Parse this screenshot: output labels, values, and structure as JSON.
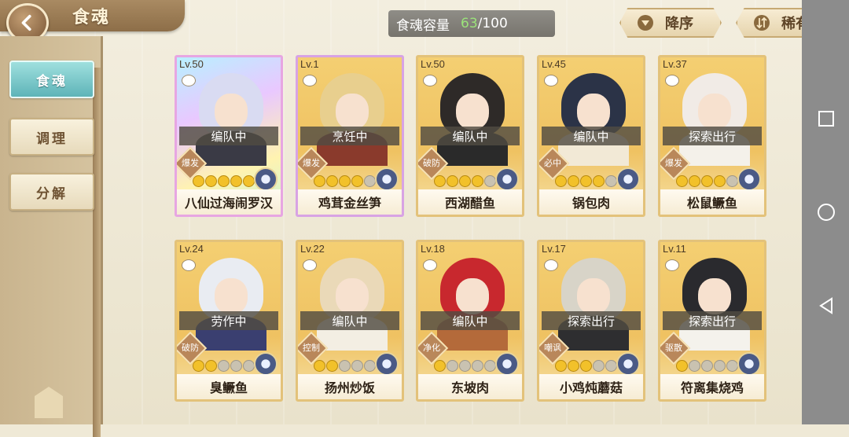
{
  "header": {
    "title": "食魂",
    "capacity_label": "食魂容量",
    "capacity_count": "63",
    "capacity_max": "/100"
  },
  "sort": {
    "order_label": "降序",
    "rarity_label": "稀有度"
  },
  "sidebar": {
    "items": [
      {
        "label": "食魂",
        "active": true
      },
      {
        "label": "调理",
        "active": false
      },
      {
        "label": "分解",
        "active": false
      }
    ]
  },
  "cards": [
    {
      "level": "Lv.50",
      "status": "编队中",
      "role": "爆发",
      "stars": 5,
      "name": "八仙过海闹罗汉",
      "frame": "rainbow",
      "hair": "#d9dbf2",
      "outfit": "#3a3a45"
    },
    {
      "level": "Lv.1",
      "status": "烹饪中",
      "role": "爆发",
      "stars": 4,
      "name": "鸡茸金丝笋",
      "frame": "purple",
      "hair": "#e8cf8e",
      "outfit": "#8a3a2c"
    },
    {
      "level": "Lv.50",
      "status": "编队中",
      "role": "破防",
      "stars": 4,
      "name": "西湖醋鱼",
      "frame": "gold",
      "hair": "#2e2a28",
      "outfit": "#2a2a2a"
    },
    {
      "level": "Lv.45",
      "status": "编队中",
      "role": "必中",
      "stars": 4,
      "name": "锅包肉",
      "frame": "gold",
      "hair": "#2b3347",
      "outfit": "#f2e9d6"
    },
    {
      "level": "Lv.37",
      "status": "探索出行",
      "role": "爆发",
      "stars": 4,
      "name": "松鼠鳜鱼",
      "frame": "gold",
      "hair": "#f1ebe6",
      "outfit": "#f4f1ea"
    },
    {
      "level": "Lv.24",
      "status": "劳作中",
      "role": "破防",
      "stars": 2,
      "name": "臭鳜鱼",
      "frame": "gold",
      "hair": "#e9ecf2",
      "outfit": "#3a3f70"
    },
    {
      "level": "Lv.22",
      "status": "编队中",
      "role": "控制",
      "stars": 2,
      "name": "扬州炒饭",
      "frame": "gold",
      "hair": "#ead9b8",
      "outfit": "#f3eee3"
    },
    {
      "level": "Lv.18",
      "status": "编队中",
      "role": "净化",
      "stars": 1,
      "name": "东坡肉",
      "frame": "gold",
      "hair": "#c8282e",
      "outfit": "#b46a3a"
    },
    {
      "level": "Lv.17",
      "status": "探索出行",
      "role": "嘲讽",
      "stars": 3,
      "name": "小鸡炖蘑菇",
      "frame": "gold",
      "hair": "#d8d4c8",
      "outfit": "#2e2e30"
    },
    {
      "level": "Lv.11",
      "status": "探索出行",
      "role": "驱散",
      "stars": 1,
      "name": "符离集烧鸡",
      "frame": "gold",
      "hair": "#2a2a2e",
      "outfit": "#f4f2ec"
    }
  ],
  "icons": {
    "back": "chevron-left-icon",
    "sort_order": "triangle-down-icon",
    "sort_rarity": "sort-arrows-icon"
  }
}
